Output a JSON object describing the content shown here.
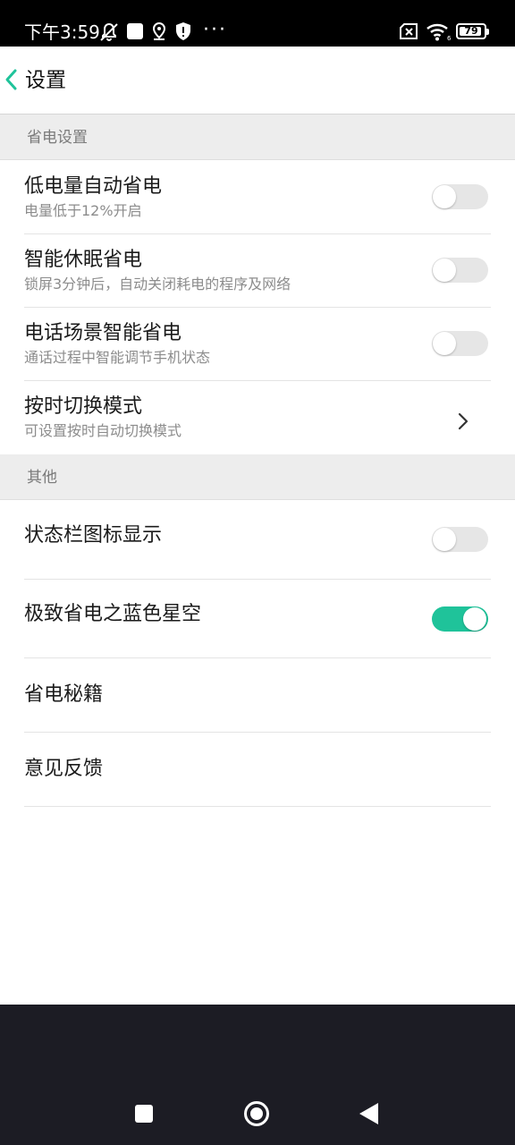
{
  "status_bar": {
    "time": "下午3:59",
    "icons": [
      "notifications-off-icon",
      "square-app-icon",
      "location-icon",
      "shield-icon",
      "more-dots-icon",
      "no-sim-icon",
      "wifi-icon",
      "battery-icon"
    ],
    "dots": "···",
    "battery_level": "79"
  },
  "header": {
    "title": "设置",
    "back_icon": "chevron-left-icon",
    "accent_color": "#1fc39a"
  },
  "sections": [
    {
      "title": "省电设置",
      "items": [
        {
          "label": "低电量自动省电",
          "subtitle": "电量低于12%开启",
          "control": "toggle",
          "on": false
        },
        {
          "label": "智能休眠省电",
          "subtitle": "锁屏3分钟后，自动关闭耗电的程序及网络",
          "control": "toggle",
          "on": false
        },
        {
          "label": "电话场景智能省电",
          "subtitle": "通话过程中智能调节手机状态",
          "control": "toggle",
          "on": false
        },
        {
          "label": "按时切换模式",
          "subtitle": "可设置按时自动切换模式",
          "control": "chevron"
        }
      ]
    },
    {
      "title": "其他",
      "items": [
        {
          "label": "状态栏图标显示",
          "control": "toggle",
          "on": false
        },
        {
          "label": "极致省电之蓝色星空",
          "control": "toggle",
          "on": true
        },
        {
          "label": "省电秘籍"
        },
        {
          "label": "意见反馈"
        }
      ]
    }
  ],
  "nav_bar": {
    "buttons": [
      "recents-square-icon",
      "home-circle-icon",
      "back-triangle-icon"
    ]
  }
}
